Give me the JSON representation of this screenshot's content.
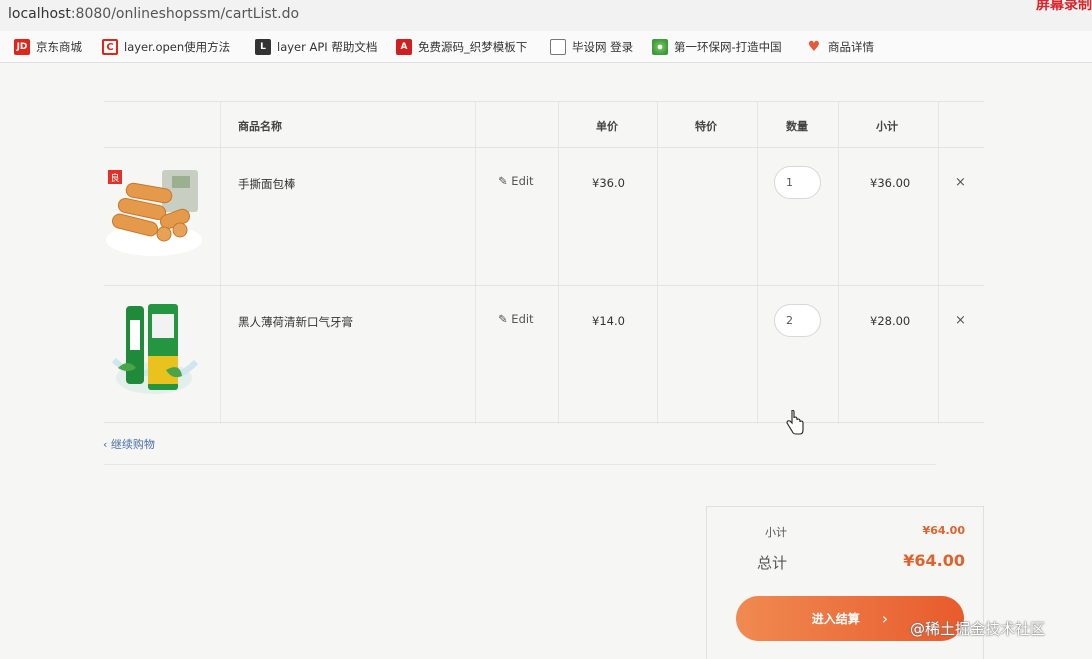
{
  "browser": {
    "url_host": "localhost",
    "url_rest": ":8080/onlineshopssm/cartList.do",
    "recording_label": "屏幕录制"
  },
  "bookmarks": [
    {
      "icon": "jd-icon",
      "badge": "JD",
      "label": "京东商城"
    },
    {
      "icon": "layer-icon",
      "badge": "C",
      "label": "layer.open使用方法"
    },
    {
      "icon": "layer-api-icon",
      "badge": "L",
      "label": "layer API 帮助文档"
    },
    {
      "icon": "adobe-icon",
      "badge": "A",
      "label": "免费源码_织梦模板下"
    },
    {
      "icon": "document-icon",
      "badge": "",
      "label": "毕设网 登录"
    },
    {
      "icon": "swirl-icon",
      "badge": "",
      "label": "第一环保网-打造中国"
    },
    {
      "icon": "heart-icon",
      "badge": "♥",
      "label": "商品详情"
    }
  ],
  "table": {
    "headers": {
      "name": "商品名称",
      "price": "单价",
      "special": "特价",
      "qty": "数量",
      "subtotal": "小计"
    },
    "rows": [
      {
        "name": "手撕面包棒",
        "edit": "Edit",
        "price": "¥36.0",
        "special": "",
        "qty": "1",
        "subtotal": "¥36.00",
        "remove": "×"
      },
      {
        "name": "黑人薄荷清新口气牙膏",
        "edit": "Edit",
        "price": "¥14.0",
        "special": "",
        "qty": "2",
        "subtotal": "¥28.00",
        "remove": "×"
      }
    ]
  },
  "continue_shopping": "‹ 继续购物",
  "summary": {
    "subtotal_label": "小计",
    "subtotal_value": "¥64.00",
    "total_label": "总计",
    "total_value": "¥64.00",
    "checkout_label": "进入结算",
    "checkout_chevron": "›"
  },
  "watermark": "@稀土掘金技术社区",
  "colors": {
    "accent": "#e0632f",
    "button_start": "#f08a52",
    "button_end": "#e85b2c",
    "link": "#4b6ea8"
  }
}
